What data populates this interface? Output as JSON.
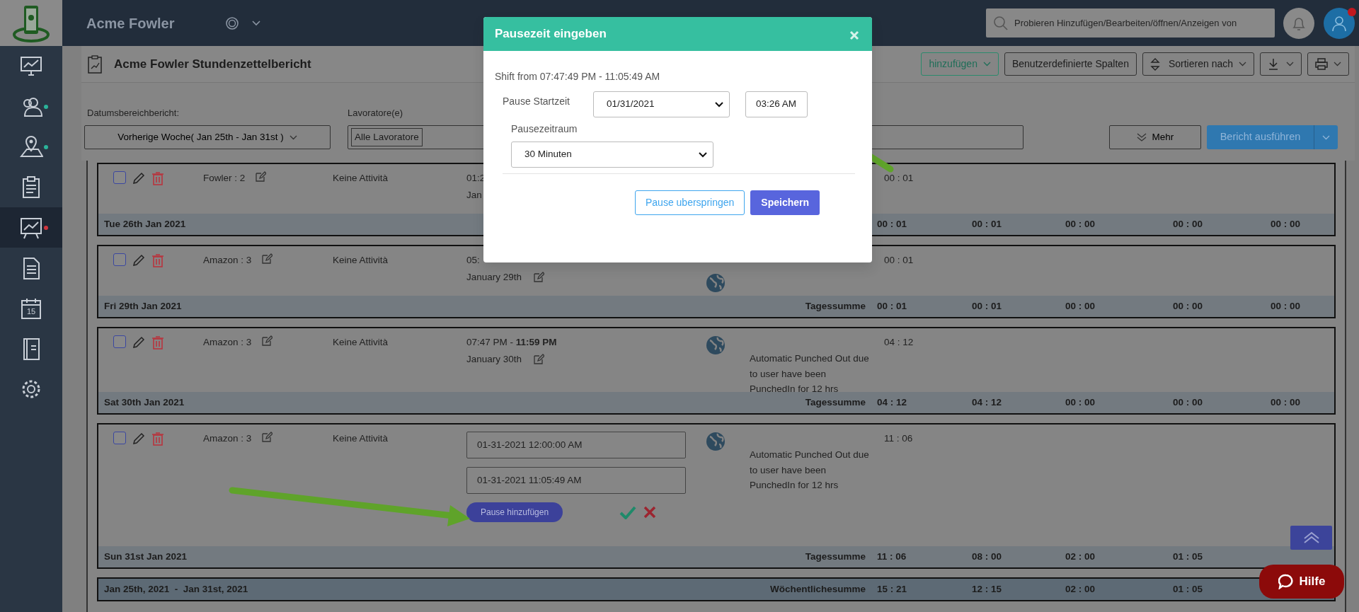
{
  "app": {
    "title": "Acme Fowler"
  },
  "sidebar": {
    "items": [
      {
        "kind": "monitor",
        "selected": false
      },
      {
        "kind": "users",
        "selected": false,
        "color": "#2bb39a"
      },
      {
        "kind": "map",
        "selected": false,
        "color": "#2bb39a"
      },
      {
        "kind": "clipboard",
        "selected": false
      },
      {
        "kind": "chart",
        "selected": true,
        "color": "#d0363f"
      },
      {
        "kind": "document",
        "selected": false
      },
      {
        "kind": "calendar",
        "selected": false,
        "text": "15"
      },
      {
        "kind": "book",
        "selected": false
      },
      {
        "kind": "gear",
        "selected": false
      }
    ]
  },
  "search": {
    "placeholder": "Probieren Hinzufügen/Bearbeiten/öffnen/Anzeigen von"
  },
  "profile": {
    "alert": true
  },
  "page": {
    "title": "Acme Fowler Stundenzettelbericht",
    "toolbar": [
      {
        "kind": "success",
        "label": "hinzufügen"
      },
      {
        "kind": "plain",
        "label": "Benutzerdefinierte Spalten"
      },
      {
        "kind": "sort",
        "label": "Sortieren nach"
      },
      {
        "kind": "download"
      },
      {
        "kind": "print"
      }
    ]
  },
  "filters": {
    "date_range": {
      "label": "Datumsbereichbericht:",
      "value": "Vorherige Woche( Jan 25th - Jan 31st )"
    },
    "workers": {
      "label": "Lavoratore(e)",
      "value": "Alle Lavoratore"
    },
    "more_button": "Mehr",
    "run_button": "Bericht ausführen"
  },
  "days": [
    {
      "kind": "view",
      "checked": false,
      "project": "Fowler : 2",
      "activity": "Keine Attività",
      "time": "01:2",
      "date": "Jan",
      "globe": false,
      "hours": "00 : 01",
      "summary": {
        "date": "Tue 26th Jan 2021",
        "values": [
          "00 : 01",
          "00 : 01",
          "00 : 00",
          "00 : 00",
          "00 : 00"
        ]
      }
    },
    {
      "kind": "view",
      "checked": false,
      "project": "Amazon : 3",
      "activity": "Keine Attività",
      "time": "05:",
      "date": "January 29th",
      "globe": true,
      "hours": "00 : 01",
      "summary": {
        "date": "Fri 29th Jan 2021",
        "label": "Tagessumme",
        "values": [
          "00 : 01",
          "00 : 01",
          "00 : 00",
          "00 : 00",
          "00 : 00"
        ]
      }
    },
    {
      "kind": "view",
      "checked": false,
      "project": "Amazon : 3",
      "activity": "Keine Attività",
      "time": "07:47 PM - **11:59 PM**",
      "date": "January 30th",
      "globe": true,
      "note": "Automatic Punched Out due to user have been PunchedIn for 12 hrs",
      "hours": "04 : 12",
      "summary": {
        "date": "Sat 30th Jan 2021",
        "label": "Tagessumme",
        "values": [
          "04 : 12",
          "04 : 12",
          "00 : 00",
          "00 : 00",
          "00 : 00"
        ]
      }
    },
    {
      "kind": "edit",
      "checked": false,
      "project": "Amazon : 3",
      "activity": "Keine Attività",
      "start": "01-31-2021 12:00:00 AM",
      "end": "01-31-2021 11:05:49 AM",
      "pause_button": "Pause hinzufügen",
      "globe": true,
      "note": "Automatic Punched Out due to user have been PunchedIn for 12 hrs",
      "hours": "11 : 06",
      "summary": {
        "date": "Sun 31st Jan 2021",
        "label": "Tagessumme",
        "values": [
          "11 : 06",
          "08 : 00",
          "02 : 00",
          "01 : 05"
        ]
      }
    }
  ],
  "weekly": {
    "range": "Jan 25th, 2021  -  Jan 31st, 2021",
    "label": "Wöchentlichesumme",
    "values": [
      "15 : 21",
      "12 : 15",
      "02 : 00",
      "01 : 05"
    ]
  },
  "help_button": "Hilfe",
  "modal": {
    "title": "Pausezeit eingeben",
    "shift": "Shift from 07:47:49 PM - 11:05:49 AM",
    "start_label": "Pause Startzeit",
    "start_date": "01/31/2021",
    "start_time": "03:26 AM",
    "duration_label": "Pausezeitraum",
    "duration": "30 Minuten",
    "skip_button": "Pause uberspringen",
    "save_button": "Speichern"
  }
}
